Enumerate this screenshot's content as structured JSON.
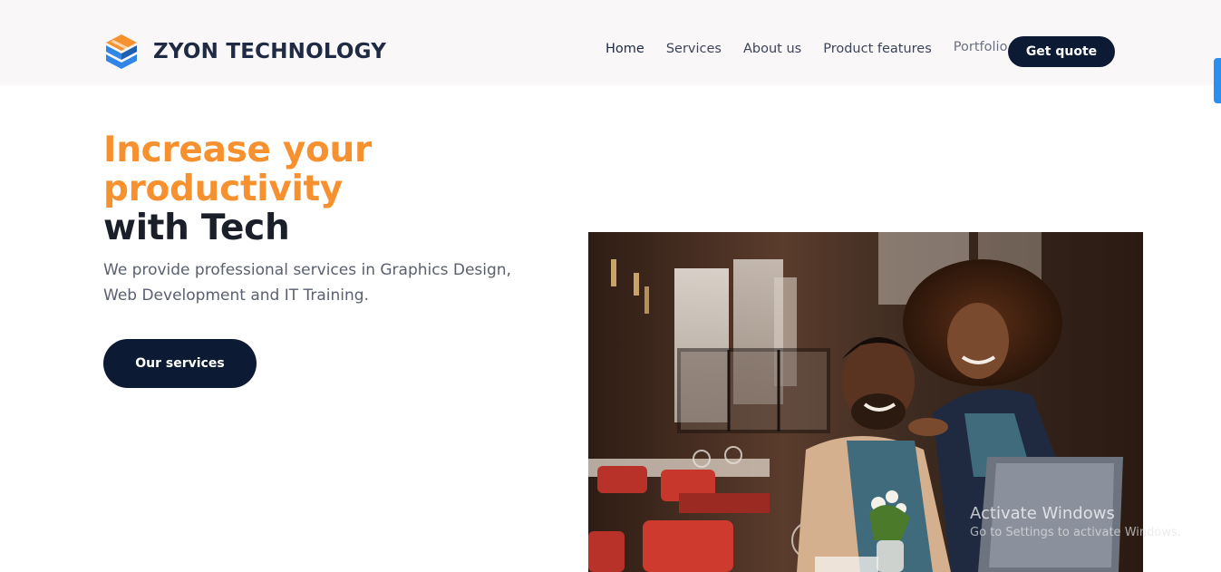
{
  "header": {
    "brand_name": "ZYON TECHNOLOGY",
    "logo_icon": "zyon-logo-icon",
    "nav": [
      {
        "label": "Home"
      },
      {
        "label": "Services"
      },
      {
        "label": "About us"
      },
      {
        "label": "Product features"
      },
      {
        "label": "Portfolio"
      }
    ],
    "cta_label": "Get quote"
  },
  "hero": {
    "title_line1": "Increase your",
    "title_line2": "productivity",
    "title_line3": "with Tech",
    "subtitle": "We provide professional services in Graphics Design, Web Development and IT Training.",
    "button_label": "Our services",
    "image_alt_icon": "hero-photo-two-people-laptop"
  },
  "watermark": {
    "title": "Activate Windows",
    "subtitle": "Go to Settings to activate Windows."
  },
  "colors": {
    "accent": "#f7912f",
    "primary_dark": "#0c1a33",
    "header_bg": "#faf7f9",
    "logo_orange": "#f7912f",
    "logo_blue": "#2f86e6"
  }
}
